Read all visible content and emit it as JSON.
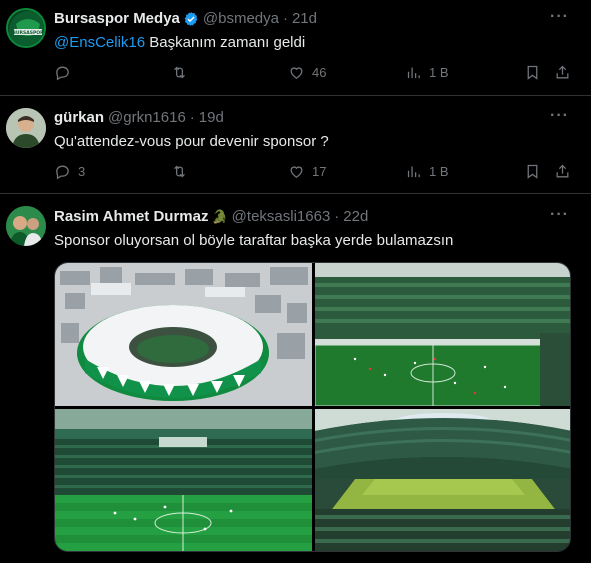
{
  "tweets": [
    {
      "name": "Bursaspor Medya",
      "handle": "@bsmedya",
      "time": "21d",
      "mention": "@EnsCelik16",
      "text": " Başkanım zamanı geldi",
      "reply_count": "",
      "repost_count": "",
      "like_count": "46",
      "view_count": "1 B",
      "avatar_text": "BURSASPOR"
    },
    {
      "name": "gürkan",
      "handle": "@grkn1616",
      "time": "19d",
      "text": "Qu'attendez-vous pour devenir sponsor ?",
      "reply_count": "3",
      "repost_count": "",
      "like_count": "17",
      "view_count": "1 B"
    },
    {
      "name": "Rasim Ahmet Durmaz",
      "handle": "@teksasli1663",
      "time": "22d",
      "text": "Sponsor oluyorsan ol böyle taraftar başka yerde bulamazsın",
      "emoji": "🐊"
    }
  ],
  "separator": "·",
  "more": "···",
  "icons": {
    "reply": "reply-icon",
    "repost": "repost-icon",
    "like": "like-icon",
    "views": "views-icon",
    "bookmark": "bookmark-icon",
    "share": "share-icon",
    "verified": "verified-badge-icon"
  },
  "colors": {
    "background": "#000000",
    "accent": "#1d9bf0",
    "muted": "#71767b",
    "text": "#e7e9ea",
    "bursa_green": "#0a8a3a"
  }
}
